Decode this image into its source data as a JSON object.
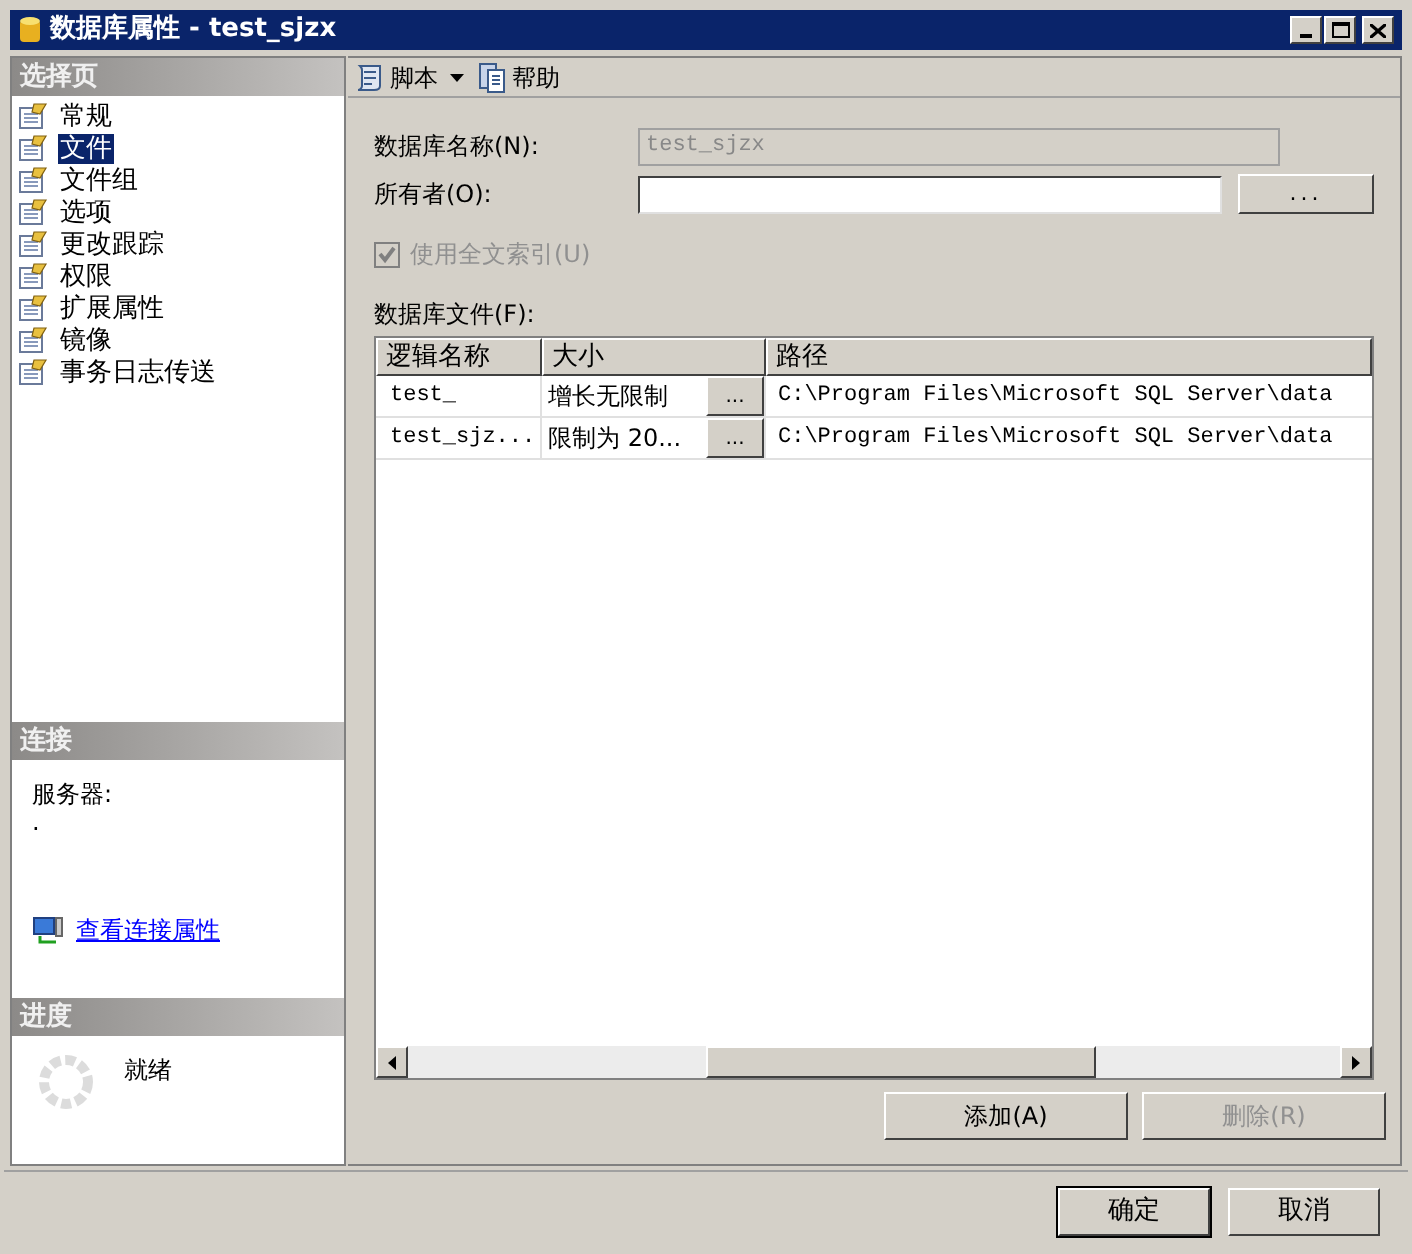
{
  "window": {
    "title": "数据库属性 - test_sjzx"
  },
  "sidebar": {
    "header": "选择页",
    "pages": [
      {
        "label": "常规",
        "selected": false
      },
      {
        "label": "文件",
        "selected": true
      },
      {
        "label": "文件组",
        "selected": false
      },
      {
        "label": "选项",
        "selected": false
      },
      {
        "label": "更改跟踪",
        "selected": false
      },
      {
        "label": "权限",
        "selected": false
      },
      {
        "label": "扩展属性",
        "selected": false
      },
      {
        "label": "镜像",
        "selected": false
      },
      {
        "label": "事务日志传送",
        "selected": false
      }
    ]
  },
  "connection": {
    "header": "连接",
    "server_label": "服务器:",
    "server_value": ".",
    "link": "查看连接属性"
  },
  "progress": {
    "header": "进度",
    "status": "就绪"
  },
  "toolbar": [
    {
      "label": "脚本",
      "kind": "script"
    },
    {
      "label": "帮助",
      "kind": "help"
    }
  ],
  "form": {
    "name_label": "数据库名称(N):",
    "name_value": "test_sjzx",
    "owner_label": "所有者(O):",
    "owner_button": "...",
    "fulltext": {
      "label": "使用全文索引(U)",
      "checked": true,
      "disabled": true
    }
  },
  "files": {
    "label": "数据库文件(F):",
    "columns": [
      "逻辑名称",
      "大小",
      "路径"
    ],
    "rows": [
      {
        "logical_name": "test_",
        "size": "增长无限制",
        "button": "...",
        "path": "C:\\Program Files\\Microsoft SQL Server\\data"
      },
      {
        "logical_name": "test_sjz...",
        "size": "限制为 20...",
        "button": "...",
        "path": "C:\\Program Files\\Microsoft SQL Server\\data"
      }
    ]
  },
  "file_buttons": [
    {
      "label": "添加(A)",
      "disabled": false
    },
    {
      "label": "删除(R)",
      "disabled": true
    }
  ],
  "dialog_buttons": [
    {
      "label": "确定",
      "default": true
    },
    {
      "label": "取消",
      "default": false
    }
  ]
}
